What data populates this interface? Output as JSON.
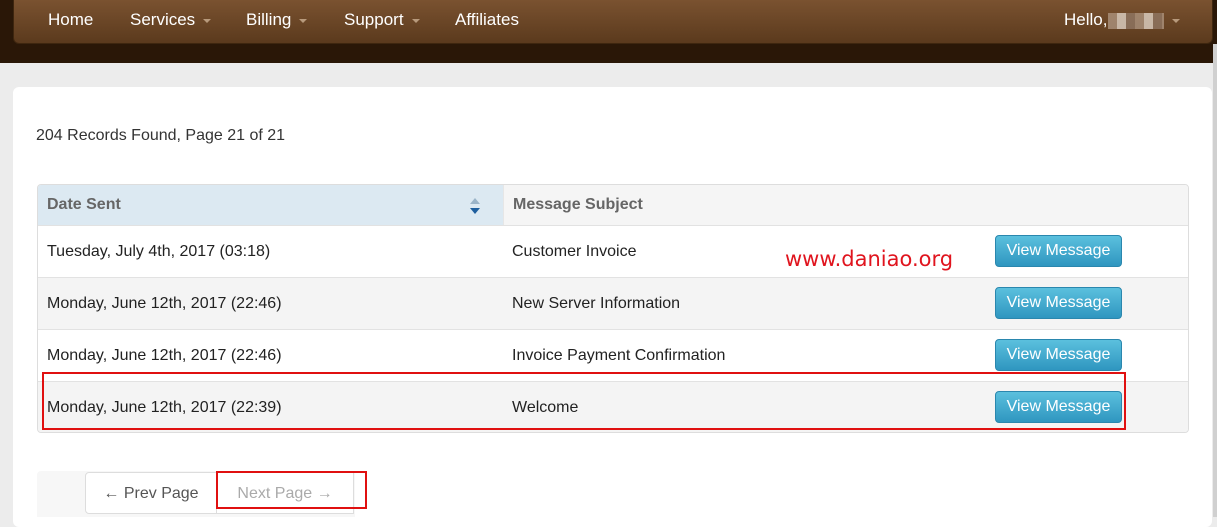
{
  "nav": {
    "items": [
      {
        "label": "Home",
        "dropdown": false
      },
      {
        "label": "Services",
        "dropdown": true
      },
      {
        "label": "Billing",
        "dropdown": true
      },
      {
        "label": "Support",
        "dropdown": true
      },
      {
        "label": "Affiliates",
        "dropdown": false
      }
    ],
    "user_greeting": "Hello,"
  },
  "records_summary": "204 Records Found, Page 21 of 21",
  "table": {
    "columns": [
      "Date Sent",
      "Message Subject"
    ],
    "rows": [
      {
        "date": "Tuesday, July 4th, 2017 (03:18)",
        "subject": "Customer Invoice",
        "action": "View Message"
      },
      {
        "date": "Monday, June 12th, 2017 (22:46)",
        "subject": "New Server Information",
        "action": "View Message"
      },
      {
        "date": "Monday, June 12th, 2017 (22:46)",
        "subject": "Invoice Payment Confirmation",
        "action": "View Message"
      },
      {
        "date": "Monday, June 12th, 2017 (22:39)",
        "subject": "Welcome",
        "action": "View Message"
      }
    ]
  },
  "watermark": "www.daniao.org",
  "pagination": {
    "prev_label": "← Prev Page",
    "next_label": "Next Page →"
  },
  "colors": {
    "navbar": "#6b4526",
    "button": "#3ea8d3",
    "annotation": "#e01010"
  }
}
